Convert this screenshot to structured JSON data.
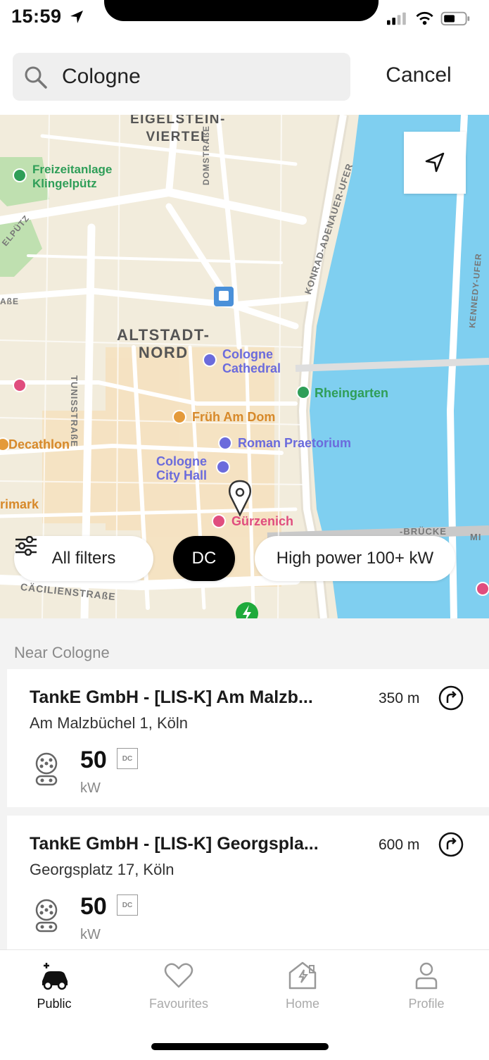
{
  "status_bar": {
    "time": "15:59"
  },
  "search": {
    "value": "Cologne",
    "cancel_label": "Cancel"
  },
  "map": {
    "labels": {
      "eigelstein": "EIGELSTEIN-\nVIERTEL",
      "freizeitanlage": "Freizeitanlage\nKlingelpütz",
      "altstadt": "ALTSTADT-\nNORD",
      "cathedral": "Cologne\nCathedral",
      "rheingarten": "Rheingarten",
      "frueh": "Früh Am Dom",
      "decathlon": "Decathlon",
      "praetorium": "Roman Praetorium",
      "city_hall": "Cologne\nCity Hall",
      "primark": "rimark",
      "guerzenich": "Gürzenich",
      "domstrasse": "DOMSTRAßE",
      "konrad": "KONRAD-ADENAUER-UFER",
      "tunisstrasse": "TUNISSTRAßE",
      "kennedy": "KENNEDY-UFER",
      "caecilien": "CÄCILIENSTRAßE",
      "bruecke": "-BRÜCKE",
      "mi": "MI",
      "abe": "AßE",
      "putz": "ELPÜTZ"
    },
    "colors": {
      "water": "#7fcff0",
      "park": "#bfe0b0",
      "land": "#f2ecdc",
      "road": "#ffffff"
    }
  },
  "filters": {
    "all_filters": "All filters",
    "dc": "DC",
    "high_power": "High power 100+ kW"
  },
  "results": {
    "header": "Near Cologne",
    "items": [
      {
        "name": "TankE GmbH - [LIS-K] Am Malzb...",
        "address": "Am Malzbüchel 1, Köln",
        "distance": "350 m",
        "power": "50",
        "unit": "kW",
        "connector": "DC"
      },
      {
        "name": "TankE GmbH - [LIS-K] Georgspla...",
        "address": "Georgsplatz  17, Köln",
        "distance": "600 m",
        "power": "50",
        "unit": "kW",
        "connector": "DC"
      }
    ]
  },
  "tabs": [
    {
      "label": "Public",
      "icon": "car-charging-icon",
      "active": true
    },
    {
      "label": "Favourites",
      "icon": "heart-icon",
      "active": false
    },
    {
      "label": "Home",
      "icon": "home-charging-icon",
      "active": false
    },
    {
      "label": "Profile",
      "icon": "person-icon",
      "active": false
    }
  ]
}
